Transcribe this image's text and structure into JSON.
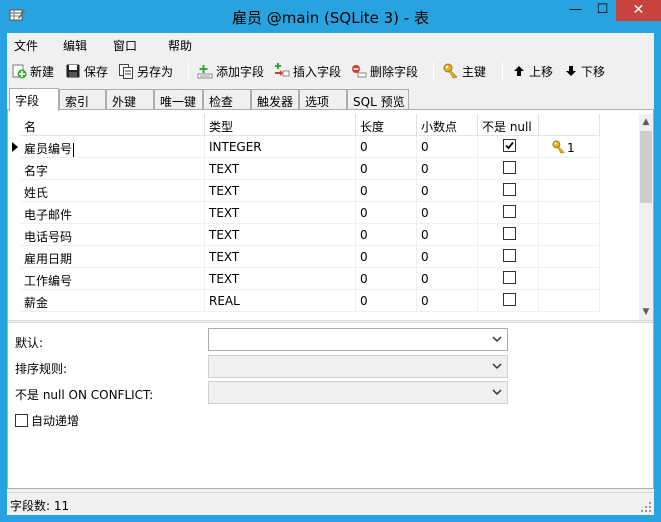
{
  "window": {
    "title": "雇员 @main (SQLite 3) - 表",
    "minimize_glyph": "—",
    "maximize_glyph": "☐",
    "close_glyph": "✕"
  },
  "menu": [
    "文件",
    "编辑",
    "窗口",
    "帮助"
  ],
  "toolbar": {
    "new_label": "新建",
    "save_label": "保存",
    "save_as_label": "另存为",
    "add_field_label": "添加字段",
    "insert_field_label": "插入字段",
    "delete_field_label": "删除字段",
    "primary_key_label": "主键",
    "move_up_label": "上移",
    "move_down_label": "下移"
  },
  "tabs": [
    "字段",
    "索引",
    "外键",
    "唯一键",
    "检查",
    "触发器",
    "选项",
    "SQL 预览"
  ],
  "grid": {
    "columns": [
      "名",
      "类型",
      "长度",
      "小数点",
      "不是 null",
      ""
    ],
    "rows": [
      {
        "name": "雇员编号",
        "type": "INTEGER",
        "length": "0",
        "decimals": "0",
        "not_null": true,
        "key": "1"
      },
      {
        "name": "名字",
        "type": "TEXT",
        "length": "0",
        "decimals": "0",
        "not_null": false,
        "key": ""
      },
      {
        "name": "姓氏",
        "type": "TEXT",
        "length": "0",
        "decimals": "0",
        "not_null": false,
        "key": ""
      },
      {
        "name": "电子邮件",
        "type": "TEXT",
        "length": "0",
        "decimals": "0",
        "not_null": false,
        "key": ""
      },
      {
        "name": "电话号码",
        "type": "TEXT",
        "length": "0",
        "decimals": "0",
        "not_null": false,
        "key": ""
      },
      {
        "name": "雇用日期",
        "type": "TEXT",
        "length": "0",
        "decimals": "0",
        "not_null": false,
        "key": ""
      },
      {
        "name": "工作编号",
        "type": "TEXT",
        "length": "0",
        "decimals": "0",
        "not_null": false,
        "key": ""
      },
      {
        "name": "薪金",
        "type": "REAL",
        "length": "0",
        "decimals": "0",
        "not_null": false,
        "key": ""
      }
    ]
  },
  "properties": {
    "default_label": "默认:",
    "collation_label": "排序规则:",
    "not_null_conflict_label": "不是 null ON CONFLICT:",
    "autoincrement_label": "自动递增"
  },
  "status": {
    "field_count": "字段数: 11"
  }
}
